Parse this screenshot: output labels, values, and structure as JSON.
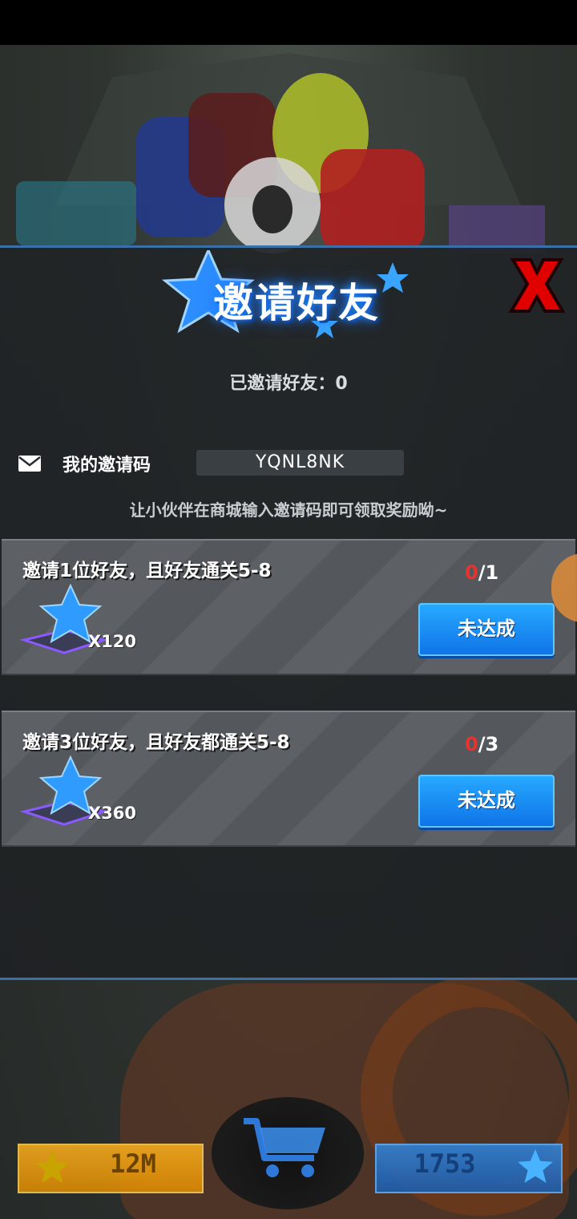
{
  "dialog": {
    "title": "邀请好友",
    "invited_text": "已邀请好友：0",
    "code_label": "我的邀请码",
    "invite_code": "YQNL8NK",
    "hint": "让小伙伴在商城输入邀请码即可领取奖励呦~"
  },
  "tasks": [
    {
      "title": "邀请1位好友，且好友通关5-8",
      "done": "0",
      "total": "/1",
      "reward_qty": "X120",
      "button": "未达成"
    },
    {
      "title": "邀请3位好友，且好友都通关5-8",
      "done": "0",
      "total": "/3",
      "reward_qty": "X360",
      "button": "未达成"
    }
  ],
  "bottom": {
    "gold": "12M",
    "gems": "1753"
  },
  "colors": {
    "accent_blue": "#1e8cff",
    "progress_red": "#e8322e",
    "button_blue": "#0f74e8",
    "close_red": "#e00000"
  },
  "icons": [
    "mail-icon",
    "star-icon",
    "close-icon",
    "cart-icon"
  ]
}
